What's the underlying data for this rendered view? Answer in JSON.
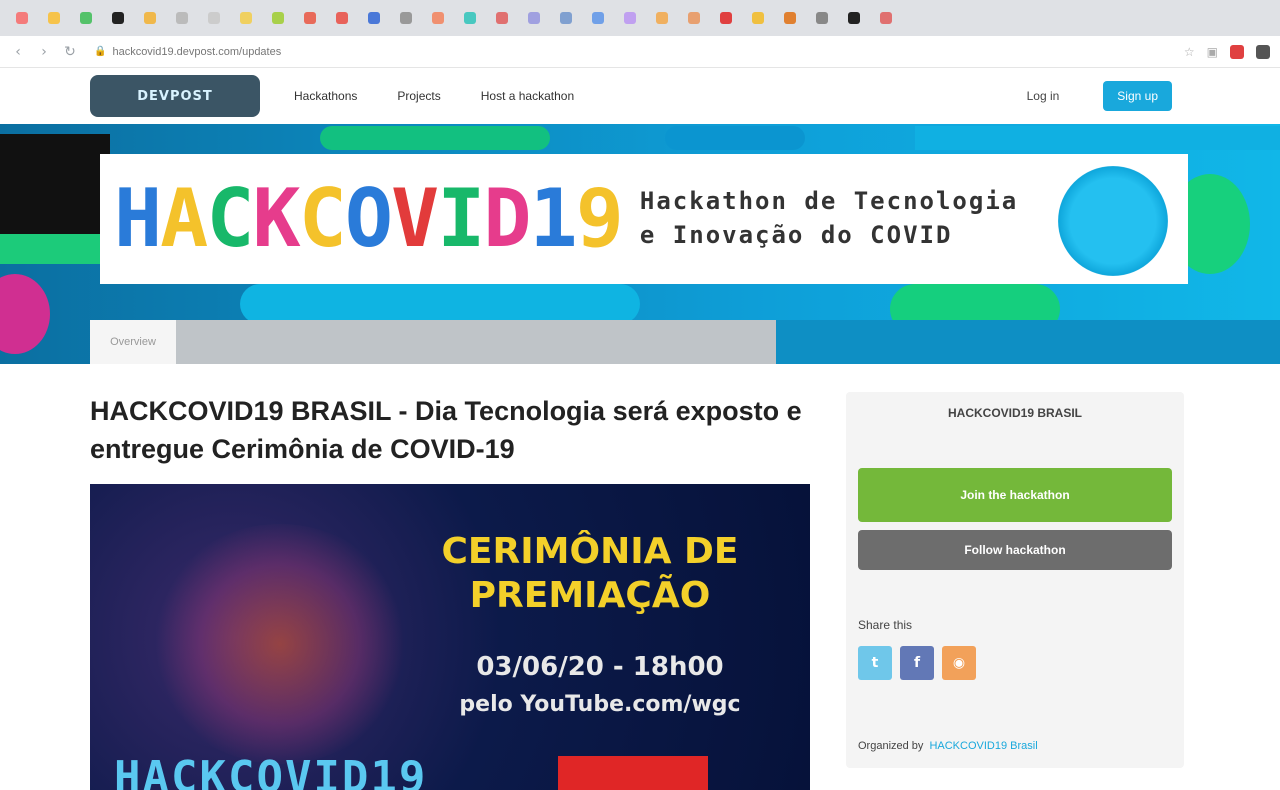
{
  "browser": {
    "tab_favicon_colors": [
      "#f47b7b",
      "#f6c34b",
      "#54c26a",
      "#222222",
      "#f0b84b",
      "#bbbbbb",
      "#cccccc",
      "#f0d060",
      "#a8d04a",
      "#e86a5a",
      "#e8625a",
      "#4a78d8",
      "#999999",
      "#f09070",
      "#48c8c0",
      "#e07070",
      "#a0a0e0",
      "#80a0d0",
      "#70a0e8",
      "#c0a0f0",
      "#f0b060",
      "#e8a070",
      "#e04040",
      "#f0c040",
      "#e08030",
      "#888888",
      "#222222",
      "#e07070"
    ],
    "url": "hackcovid19.devpost.com/updates",
    "extension_colors": [
      "#e04040",
      "#555555"
    ]
  },
  "site": {
    "logo": "DEVPOST",
    "nav": [
      "Hackathons",
      "Projects",
      "Host a hackathon"
    ],
    "login": "Log in",
    "signup": "Sign up"
  },
  "banner": {
    "title_letters": [
      "H",
      "A",
      "C",
      "K",
      "C",
      "O",
      "V",
      "I",
      "D",
      "1",
      "9"
    ],
    "title_colors": [
      "#2a7bd9",
      "#f4c22b",
      "#18b86a",
      "#e63c8c",
      "#f4c22b",
      "#2a7bd9",
      "#e23b3b",
      "#18b86a",
      "#e63c8c",
      "#2a7bd9",
      "#f4c22b"
    ],
    "subtitle_line1": "Hackathon de Tecnologia",
    "subtitle_line2": "e Inovação do COVID",
    "tab_label": "Overview"
  },
  "article": {
    "title": "HACKCOVID19 BRASIL - Dia Tecnologia será exposto e entregue Cerimônia de COVID-19",
    "image": {
      "heading": "CERIMÔNIA DE PREMIAÇÃO",
      "date": "03/06/20 - 18h00",
      "link": "pelo YouTube.com/wgc",
      "bottom": "HACKCOVID19"
    }
  },
  "sidebar": {
    "heading": "HACKCOVID19 BRASIL",
    "primary_button": "Join the hackathon",
    "secondary_button": "Follow hackathon",
    "share_label": "Share this",
    "organizer_label": "Organized by",
    "organizer_link": "HACKCOVID19 Brasil"
  }
}
